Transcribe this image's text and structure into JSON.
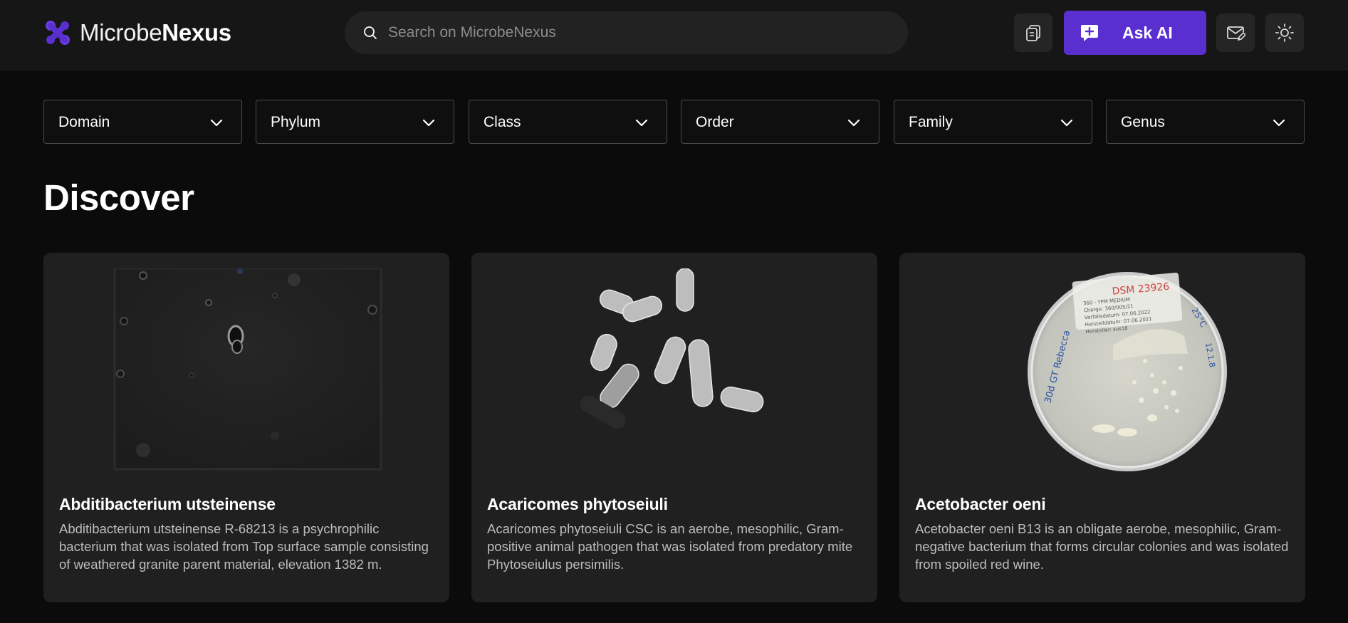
{
  "header": {
    "logo": {
      "light": "Microbe",
      "bold": "Nexus",
      "icon": "microbe-nexus-logo-icon",
      "accent": "#5a2fd0"
    },
    "search": {
      "placeholder": "Search on MicrobeNexus",
      "value": "",
      "icon": "search-icon"
    },
    "buttons": {
      "copy_icon": "copy-icon",
      "ask_ai_label": "Ask AI",
      "ask_ai_icon": "chat-plus-icon",
      "ask_ai_color": "#5a2fd0",
      "mail_icon": "mail-edit-icon",
      "theme_icon": "sun-icon"
    }
  },
  "filters": [
    {
      "label": "Domain"
    },
    {
      "label": "Phylum"
    },
    {
      "label": "Class"
    },
    {
      "label": "Order"
    },
    {
      "label": "Family"
    },
    {
      "label": "Genus"
    }
  ],
  "discover": {
    "heading": "Discover",
    "cards": [
      {
        "title": "Abditibacterium utsteinense",
        "description": "Abditibacterium utsteinense R-68213 is a psychrophilic bacterium that was isolated from Top surface sample consisting of weathered granite parent material, elevation 1382 m."
      },
      {
        "title": "Acaricomes phytoseiuli",
        "description": "Acaricomes phytoseiuli CSC is an aerobe, mesophilic, Gram-positive animal pathogen that was isolated from predatory mite Phytoseiulus persimilis."
      },
      {
        "title": "Acetobacter oeni",
        "description": "Acetobacter oeni B13 is an obligate aerobe, mesophilic, Gram-negative bacterium that forms circular colonies and was isolated from spoiled red wine.",
        "plate_label": {
          "heading": "DSM 23926",
          "lines": [
            "360 - YPM MEDIUM",
            "Charge: 360/005/21",
            "Verfallsdatum: 07.06.2022",
            "Herstelldatum: 07.06.2021",
            "Hersteller: sus18"
          ],
          "side_left": "30d GT Rebecca",
          "side_right_top": "25°C",
          "side_right_bottom": "12.1.8"
        }
      }
    ]
  }
}
